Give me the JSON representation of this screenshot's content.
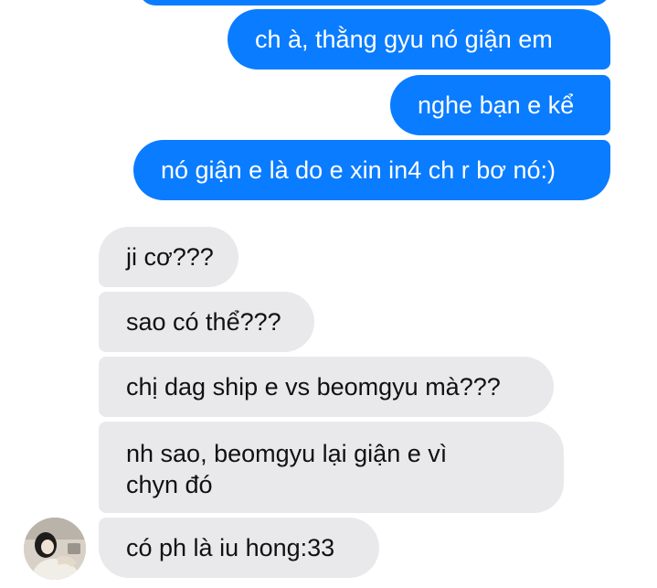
{
  "messages": {
    "outgoing": [
      "ch à, thằng gyu nó giận em",
      "nghe bạn e kể",
      "nó giận e là do e xin in4 ch r bơ nó:)"
    ],
    "incoming": [
      "ji cơ???",
      "sao có thể???",
      "chị dag ship e vs beomgyu mà???",
      "nh sao, beomgyu lại giận e vì chyn đó",
      "có ph là iu hong:33"
    ]
  },
  "colors": {
    "outgoing_bubble": "#0a7cff",
    "incoming_bubble": "#e9e9eb",
    "outgoing_text": "#ffffff",
    "incoming_text": "#111111"
  },
  "icons": {
    "avatar": "contact-avatar-photo"
  }
}
